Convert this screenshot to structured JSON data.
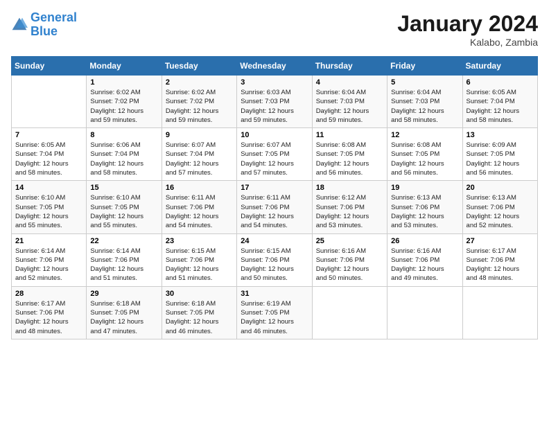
{
  "header": {
    "logo_line1": "General",
    "logo_line2": "Blue",
    "month": "January 2024",
    "location": "Kalabo, Zambia"
  },
  "days_of_week": [
    "Sunday",
    "Monday",
    "Tuesday",
    "Wednesday",
    "Thursday",
    "Friday",
    "Saturday"
  ],
  "weeks": [
    [
      {
        "day": "",
        "info": ""
      },
      {
        "day": "1",
        "info": "Sunrise: 6:02 AM\nSunset: 7:02 PM\nDaylight: 12 hours\nand 59 minutes."
      },
      {
        "day": "2",
        "info": "Sunrise: 6:02 AM\nSunset: 7:02 PM\nDaylight: 12 hours\nand 59 minutes."
      },
      {
        "day": "3",
        "info": "Sunrise: 6:03 AM\nSunset: 7:03 PM\nDaylight: 12 hours\nand 59 minutes."
      },
      {
        "day": "4",
        "info": "Sunrise: 6:04 AM\nSunset: 7:03 PM\nDaylight: 12 hours\nand 59 minutes."
      },
      {
        "day": "5",
        "info": "Sunrise: 6:04 AM\nSunset: 7:03 PM\nDaylight: 12 hours\nand 58 minutes."
      },
      {
        "day": "6",
        "info": "Sunrise: 6:05 AM\nSunset: 7:04 PM\nDaylight: 12 hours\nand 58 minutes."
      }
    ],
    [
      {
        "day": "7",
        "info": "Sunrise: 6:05 AM\nSunset: 7:04 PM\nDaylight: 12 hours\nand 58 minutes."
      },
      {
        "day": "8",
        "info": "Sunrise: 6:06 AM\nSunset: 7:04 PM\nDaylight: 12 hours\nand 58 minutes."
      },
      {
        "day": "9",
        "info": "Sunrise: 6:07 AM\nSunset: 7:04 PM\nDaylight: 12 hours\nand 57 minutes."
      },
      {
        "day": "10",
        "info": "Sunrise: 6:07 AM\nSunset: 7:05 PM\nDaylight: 12 hours\nand 57 minutes."
      },
      {
        "day": "11",
        "info": "Sunrise: 6:08 AM\nSunset: 7:05 PM\nDaylight: 12 hours\nand 56 minutes."
      },
      {
        "day": "12",
        "info": "Sunrise: 6:08 AM\nSunset: 7:05 PM\nDaylight: 12 hours\nand 56 minutes."
      },
      {
        "day": "13",
        "info": "Sunrise: 6:09 AM\nSunset: 7:05 PM\nDaylight: 12 hours\nand 56 minutes."
      }
    ],
    [
      {
        "day": "14",
        "info": "Sunrise: 6:10 AM\nSunset: 7:05 PM\nDaylight: 12 hours\nand 55 minutes."
      },
      {
        "day": "15",
        "info": "Sunrise: 6:10 AM\nSunset: 7:05 PM\nDaylight: 12 hours\nand 55 minutes."
      },
      {
        "day": "16",
        "info": "Sunrise: 6:11 AM\nSunset: 7:06 PM\nDaylight: 12 hours\nand 54 minutes."
      },
      {
        "day": "17",
        "info": "Sunrise: 6:11 AM\nSunset: 7:06 PM\nDaylight: 12 hours\nand 54 minutes."
      },
      {
        "day": "18",
        "info": "Sunrise: 6:12 AM\nSunset: 7:06 PM\nDaylight: 12 hours\nand 53 minutes."
      },
      {
        "day": "19",
        "info": "Sunrise: 6:13 AM\nSunset: 7:06 PM\nDaylight: 12 hours\nand 53 minutes."
      },
      {
        "day": "20",
        "info": "Sunrise: 6:13 AM\nSunset: 7:06 PM\nDaylight: 12 hours\nand 52 minutes."
      }
    ],
    [
      {
        "day": "21",
        "info": "Sunrise: 6:14 AM\nSunset: 7:06 PM\nDaylight: 12 hours\nand 52 minutes."
      },
      {
        "day": "22",
        "info": "Sunrise: 6:14 AM\nSunset: 7:06 PM\nDaylight: 12 hours\nand 51 minutes."
      },
      {
        "day": "23",
        "info": "Sunrise: 6:15 AM\nSunset: 7:06 PM\nDaylight: 12 hours\nand 51 minutes."
      },
      {
        "day": "24",
        "info": "Sunrise: 6:15 AM\nSunset: 7:06 PM\nDaylight: 12 hours\nand 50 minutes."
      },
      {
        "day": "25",
        "info": "Sunrise: 6:16 AM\nSunset: 7:06 PM\nDaylight: 12 hours\nand 50 minutes."
      },
      {
        "day": "26",
        "info": "Sunrise: 6:16 AM\nSunset: 7:06 PM\nDaylight: 12 hours\nand 49 minutes."
      },
      {
        "day": "27",
        "info": "Sunrise: 6:17 AM\nSunset: 7:06 PM\nDaylight: 12 hours\nand 48 minutes."
      }
    ],
    [
      {
        "day": "28",
        "info": "Sunrise: 6:17 AM\nSunset: 7:06 PM\nDaylight: 12 hours\nand 48 minutes."
      },
      {
        "day": "29",
        "info": "Sunrise: 6:18 AM\nSunset: 7:05 PM\nDaylight: 12 hours\nand 47 minutes."
      },
      {
        "day": "30",
        "info": "Sunrise: 6:18 AM\nSunset: 7:05 PM\nDaylight: 12 hours\nand 46 minutes."
      },
      {
        "day": "31",
        "info": "Sunrise: 6:19 AM\nSunset: 7:05 PM\nDaylight: 12 hours\nand 46 minutes."
      },
      {
        "day": "",
        "info": ""
      },
      {
        "day": "",
        "info": ""
      },
      {
        "day": "",
        "info": ""
      }
    ]
  ]
}
